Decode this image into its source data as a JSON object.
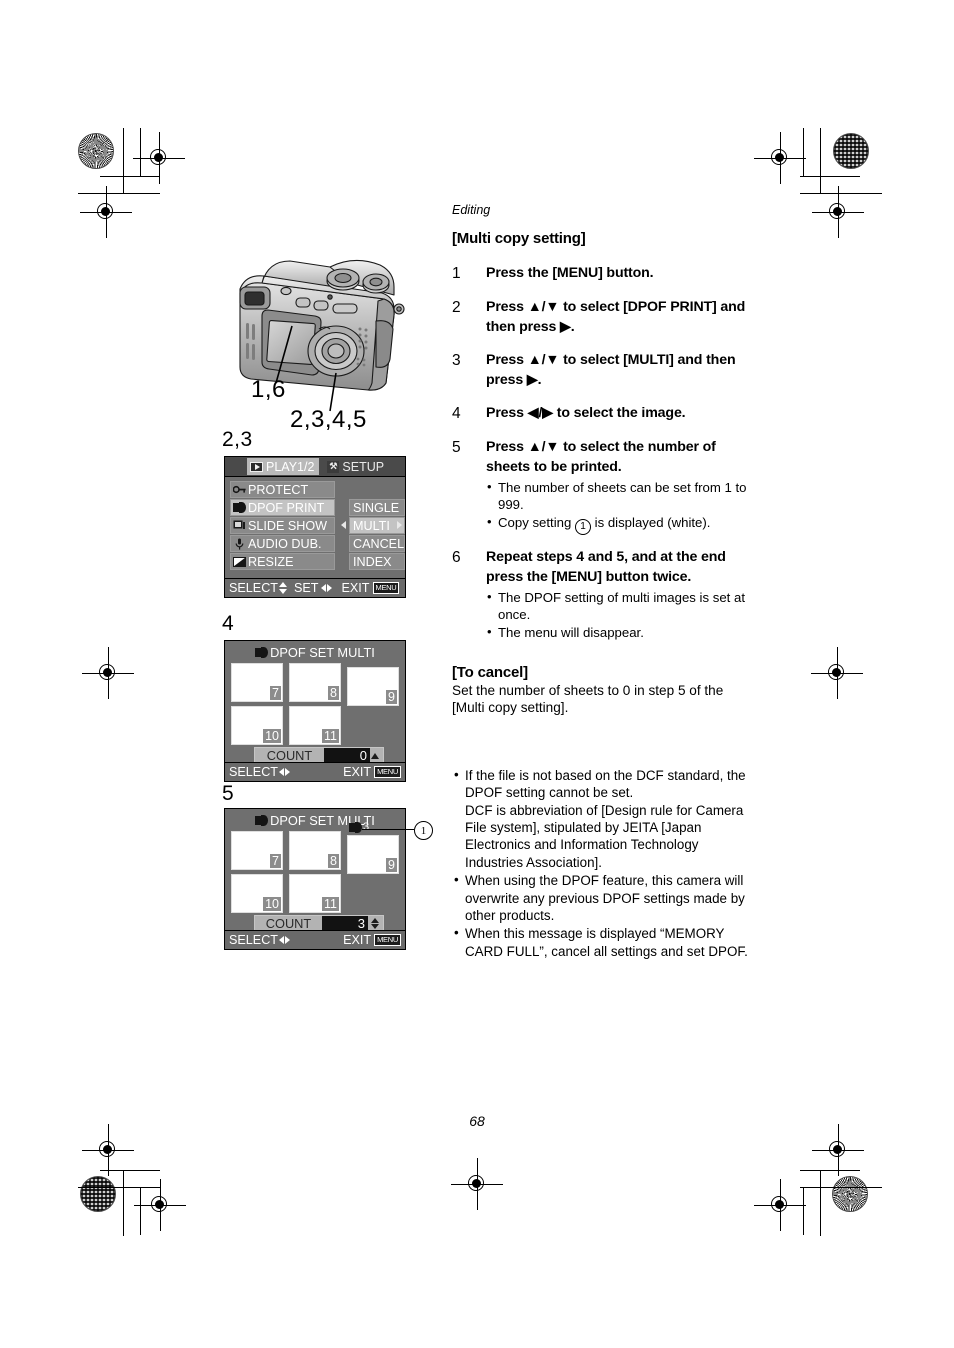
{
  "page": {
    "number": "68",
    "running_head": "Editing",
    "section_title": "[Multi copy setting]"
  },
  "steps": [
    {
      "num": "1",
      "title": "Press the [MENU] button.",
      "bullets": []
    },
    {
      "num": "2",
      "title": "Press ▲/▼ to select [DPOF PRINT] and then press ▶.",
      "bullets": []
    },
    {
      "num": "3",
      "title": "Press ▲/▼ to select [MULTI] and then press ▶.",
      "bullets": []
    },
    {
      "num": "4",
      "title": "Press ◀/▶ to select the image.",
      "bullets": []
    },
    {
      "num": "5",
      "title": "Press ▲/▼ to select the number of sheets to be printed.",
      "bullets": [
        "The number of sheets can be set from 1 to 999.",
        "Copy setting ① is displayed (white)."
      ]
    },
    {
      "num": "6",
      "title": "Repeat steps 4 and 5, and at the end press the [MENU] button twice.",
      "bullets": [
        "The DPOF setting of multi images is set at once.",
        "The menu will disappear."
      ]
    }
  ],
  "to_cancel": {
    "heading": "[To cancel]",
    "text": "Set the number of sheets to 0 in step 5 of the [Multi copy setting]."
  },
  "notes": [
    "If the file is not based on the DCF standard, the DPOF setting cannot be set. DCF is abbreviation of [Design rule for Camera File system], stipulated by JEITA [Japan Electronics and Information Technology Industries Association].",
    "When using the DPOF feature, this camera will overwrite any previous DPOF settings made by other products.",
    "When this message is displayed “MEMORY CARD FULL”, cancel all settings and set DPOF."
  ],
  "camera_figure": {
    "label_top": "1,6",
    "label_bottom": "2,3,4,5"
  },
  "figures": {
    "menu_step_mark": "2,3",
    "multi_step_mark": "4",
    "count_step_mark": "5"
  },
  "menu_screen": {
    "tabs": [
      {
        "label": "PLAY1/2",
        "icon": "play-icon",
        "selected": true
      },
      {
        "label": "SETUP",
        "icon": "setup-tools-icon",
        "selected": false
      }
    ],
    "items": [
      {
        "label": "PROTECT",
        "icon": "key-icon",
        "highlighted": false
      },
      {
        "label": "DPOF PRINT",
        "icon": "dpof-icon",
        "highlighted": true
      },
      {
        "label": "SLIDE SHOW",
        "icon": "slideshow-icon",
        "highlighted": false
      },
      {
        "label": "AUDIO DUB.",
        "icon": "microphone-icon",
        "highlighted": false
      },
      {
        "label": "RESIZE",
        "icon": "resize-icon",
        "highlighted": false
      }
    ],
    "options": [
      {
        "label": "SINGLE",
        "highlighted": false
      },
      {
        "label": "MULTI",
        "highlighted": true
      },
      {
        "label": "CANCEL",
        "highlighted": false
      },
      {
        "label": "INDEX",
        "highlighted": false
      }
    ],
    "footer": {
      "select": "SELECT",
      "set": "SET",
      "exit": "EXIT",
      "menu_badge": "MENU"
    }
  },
  "multi_screen_step4": {
    "title": "DPOF SET MULTI",
    "thumbnails": [
      {
        "number": "7",
        "badge": false
      },
      {
        "number": "8",
        "badge": false
      },
      {
        "number": "9",
        "badge": false
      },
      {
        "number": "10",
        "badge": false
      },
      {
        "number": "11",
        "badge": false
      }
    ],
    "count_label": "COUNT",
    "count_value": "0",
    "footer": {
      "select": "SELECT",
      "exit": "EXIT",
      "menu_badge": "MENU"
    }
  },
  "multi_screen_step5": {
    "title": "DPOF SET MULTI",
    "thumbnails": [
      {
        "number": "7",
        "badge": false
      },
      {
        "number": "8",
        "badge": false
      },
      {
        "number": "9",
        "badge": true,
        "badge_value": "3"
      },
      {
        "number": "10",
        "badge": false
      },
      {
        "number": "11",
        "badge": false
      }
    ],
    "count_label": "COUNT",
    "count_value": "3",
    "callout": "1",
    "footer": {
      "select": "SELECT",
      "exit": "EXIT",
      "menu_badge": "MENU"
    }
  },
  "colors": {
    "lcd_background": "#6f6f6f",
    "lcd_row": "#8a8a8a",
    "lcd_row_highlight": "#c3c3c3",
    "lcd_tabbar": "#4a4a4a",
    "lcd_count_field": "#121212"
  }
}
